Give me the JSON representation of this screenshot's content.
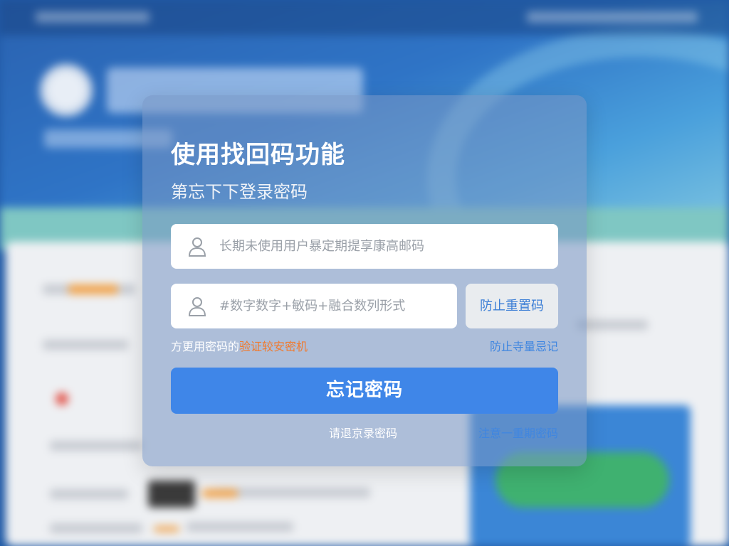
{
  "dialog": {
    "title": "使用找回码功能",
    "subtitle": "第忘下下登录密码",
    "account_field": {
      "placeholder": "长期未使用用户暴定期提享康高邮码",
      "icon": "user-icon"
    },
    "code_field": {
      "placeholder": "#数字数字+敏码+融合数列形式",
      "icon": "user-icon"
    },
    "side_button_label": "防止重置码",
    "hint_left_prefix": "方更用密码的",
    "hint_left_link": "验证较安密机",
    "hint_right_link": "防止寺量忌记",
    "primary_button_label": "忘记密码",
    "footer_center": "请退京录密码",
    "footer_right_link": "注意一重期密码"
  },
  "colors": {
    "primary": "#3f86e8",
    "link": "#3f86e0",
    "accent_orange": "#f07a2e"
  }
}
